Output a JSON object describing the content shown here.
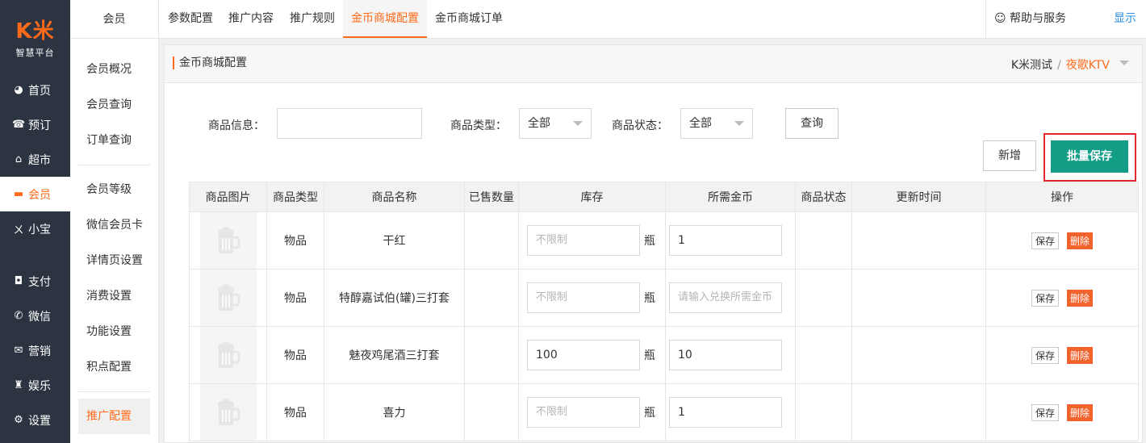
{
  "logo": {
    "mark": "K米",
    "sub": "智慧平台"
  },
  "main_nav": [
    {
      "label": "首页",
      "icon": "dashboard-icon",
      "glyph": "◕"
    },
    {
      "label": "预订",
      "icon": "reserve-icon",
      "glyph": "☎"
    },
    {
      "label": "超市",
      "icon": "basket-icon",
      "glyph": "⌂"
    },
    {
      "label": "会员",
      "icon": "card-icon",
      "glyph": "▬"
    },
    {
      "label": "小宝",
      "icon": "xiaobao-icon",
      "glyph": "ㄨ"
    },
    {
      "label": "支付",
      "icon": "payment-icon",
      "glyph": "◘"
    },
    {
      "label": "微信",
      "icon": "wechat-icon",
      "glyph": "✆"
    },
    {
      "label": "营销",
      "icon": "megaphone-icon",
      "glyph": "✉"
    },
    {
      "label": "娱乐",
      "icon": "entertainment-icon",
      "glyph": "♜"
    },
    {
      "label": "设置",
      "icon": "settings-icon",
      "glyph": "⚙"
    }
  ],
  "sub_nav": {
    "header": "会员",
    "group1": [
      "会员概况",
      "会员查询",
      "订单查询"
    ],
    "group2": [
      "会员等级",
      "微信会员卡",
      "详情页设置",
      "消费设置",
      "功能设置",
      "积点配置"
    ],
    "active": "推广配置"
  },
  "tabs": [
    "参数配置",
    "推广内容",
    "推广规则",
    "金币商城配置",
    "金币商城订单"
  ],
  "help_label": "帮助与服务",
  "show_label": "显示",
  "panel": {
    "title": "金币商城配置",
    "crumb_store": "K米测试",
    "crumb_sep": "/",
    "crumb_venue": "夜歌KTV"
  },
  "filters": {
    "info_label": "商品信息：",
    "info_value": "",
    "type_label": "商品类型：",
    "type_value": "全部",
    "status_label": "商品状态：",
    "status_value": "全部",
    "query_label": "查询"
  },
  "actions": {
    "add_label": "新增",
    "batch_save_label": "批量保存"
  },
  "colors": {
    "accent": "#ff6a1a",
    "primary_green": "#159e87",
    "danger": "#f2622c",
    "nav_bg": "#2b3440",
    "highlight_red": "#e0262e"
  },
  "table": {
    "headers": [
      "商品图片",
      "商品类型",
      "商品名称",
      "已售数量",
      "库存",
      "所需金币",
      "商品状态",
      "更新时间",
      "操作"
    ],
    "rows": [
      {
        "type": "物品",
        "name": "干红",
        "sold": "",
        "stock": "",
        "stock_placeholder": "不限制",
        "unit": "瓶",
        "gold": "1",
        "gold_placeholder": "",
        "status": "",
        "updated": "",
        "save": "保存",
        "delete": "删除"
      },
      {
        "type": "物品",
        "name": "特醇嘉试伯(罐)三打套",
        "sold": "",
        "stock": "",
        "stock_placeholder": "不限制",
        "unit": "瓶",
        "gold": "",
        "gold_placeholder": "请输入兑换所需金币",
        "status": "",
        "updated": "",
        "save": "保存",
        "delete": "删除"
      },
      {
        "type": "物品",
        "name": "魅夜鸡尾酒三打套",
        "sold": "",
        "stock": "100",
        "stock_placeholder": "",
        "unit": "瓶",
        "gold": "10",
        "gold_placeholder": "",
        "status": "",
        "updated": "",
        "save": "保存",
        "delete": "删除"
      },
      {
        "type": "物品",
        "name": "喜力",
        "sold": "",
        "stock": "",
        "stock_placeholder": "不限制",
        "unit": "瓶",
        "gold": "1",
        "gold_placeholder": "",
        "status": "",
        "updated": "",
        "save": "保存",
        "delete": "删除"
      }
    ]
  }
}
